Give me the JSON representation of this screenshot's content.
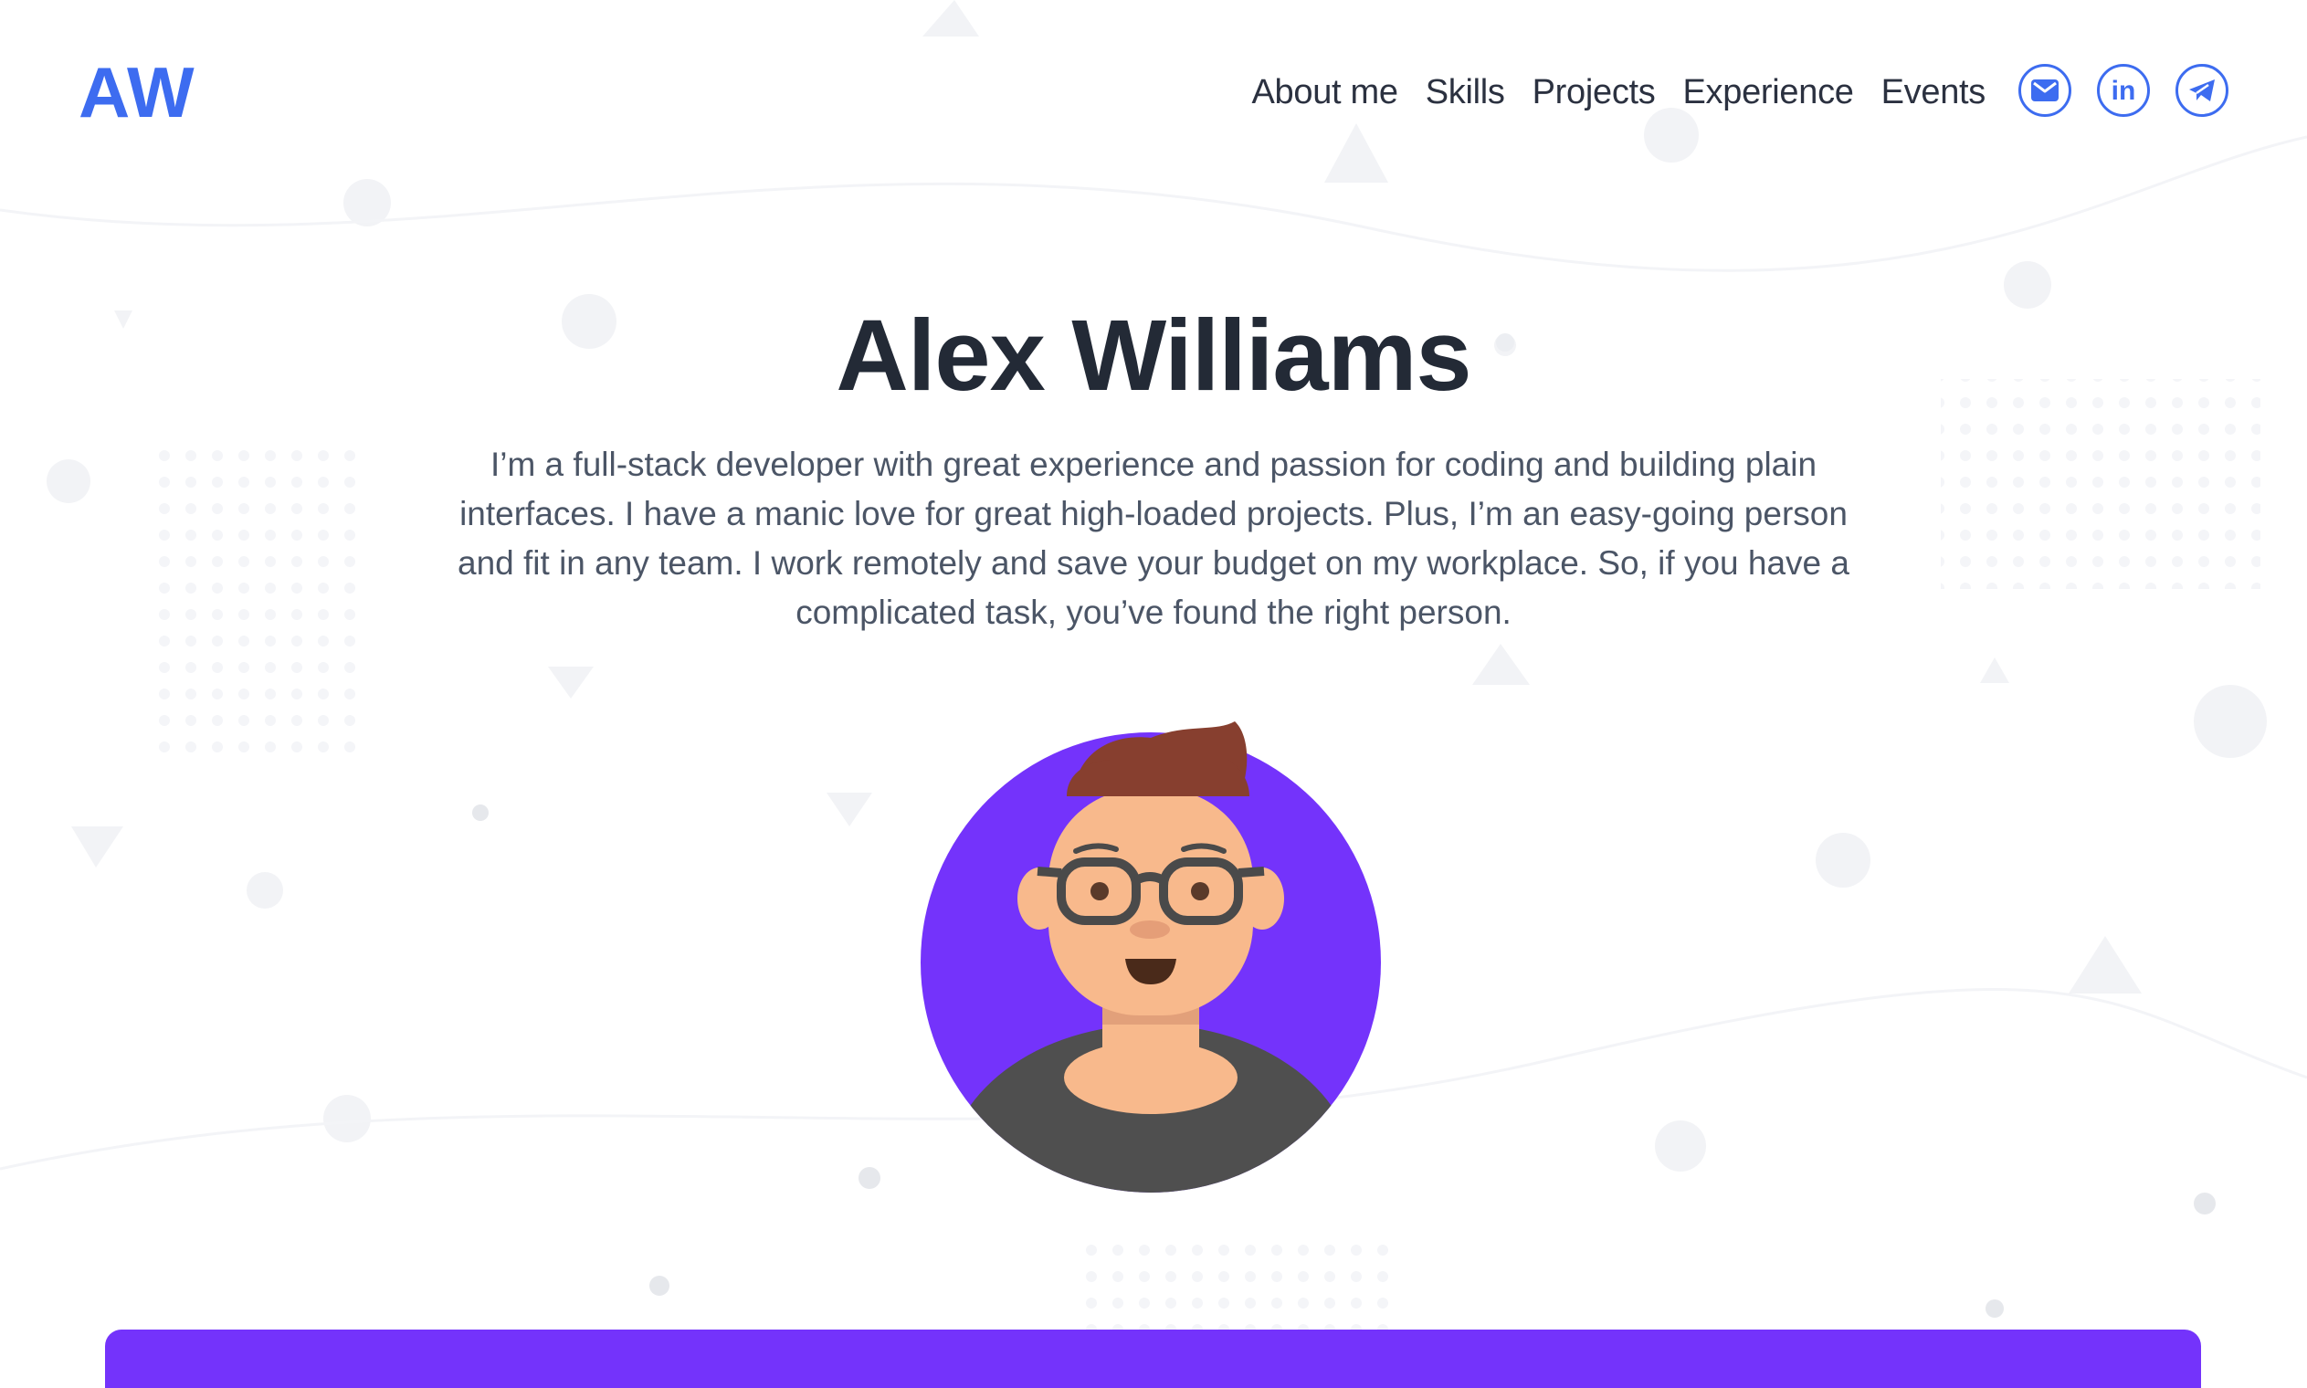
{
  "header": {
    "logo": "AW",
    "nav": [
      "About me",
      "Skills",
      "Projects",
      "Experience",
      "Events"
    ],
    "socials": [
      {
        "icon": "mail-icon",
        "name": "email"
      },
      {
        "icon": "linkedin-icon",
        "name": "linkedin",
        "text": "in"
      },
      {
        "icon": "telegram-icon",
        "name": "telegram"
      }
    ]
  },
  "hero": {
    "name": "Alex Williams",
    "bio": "I’m a full-stack developer with great experience and passion for coding and building plain interfaces. I have a manic love for great high-loaded projects. Plus, I’m an easy-going person and fit in any team. I work remotely and save your budget on my workplace. So, if you have a complicated task, you’ve found the right person."
  },
  "colors": {
    "accent": "#3d6cf0",
    "purple": "#7433fb",
    "heading": "#232a36",
    "body_text": "#4b5566"
  }
}
